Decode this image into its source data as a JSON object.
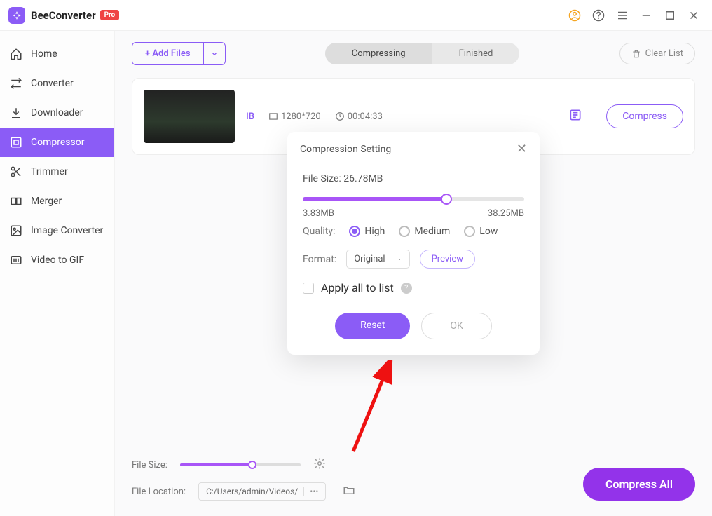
{
  "app": {
    "name": "BeeConverter",
    "badge": "Pro"
  },
  "sidebar": {
    "items": [
      {
        "label": "Home"
      },
      {
        "label": "Converter"
      },
      {
        "label": "Downloader"
      },
      {
        "label": "Compressor"
      },
      {
        "label": "Trimmer"
      },
      {
        "label": "Merger"
      },
      {
        "label": "Image Converter"
      },
      {
        "label": "Video to GIF"
      }
    ]
  },
  "toolbar": {
    "add": "+ Add Files",
    "tabs": {
      "compressing": "Compressing",
      "finished": "Finished"
    },
    "clear": "Clear List"
  },
  "file": {
    "size_visible": "IB",
    "resolution": "1280*720",
    "duration": "00:04:33",
    "compress": "Compress"
  },
  "modal": {
    "title": "Compression Setting",
    "filesize_label": "File Size: ",
    "filesize_value": "26.78MB",
    "range_min": "3.83MB",
    "range_max": "38.25MB",
    "quality_label": "Quality:",
    "quality": {
      "high": "High",
      "medium": "Medium",
      "low": "Low"
    },
    "format_label": "Format:",
    "format_value": "Original",
    "preview": "Preview",
    "apply_all": "Apply all to list",
    "reset": "Reset",
    "ok": "OK"
  },
  "footer": {
    "size_label": "File Size:",
    "loc_label": "File Location:",
    "path": "C:/Users/admin/Videos/",
    "compress_all": "Compress All"
  }
}
